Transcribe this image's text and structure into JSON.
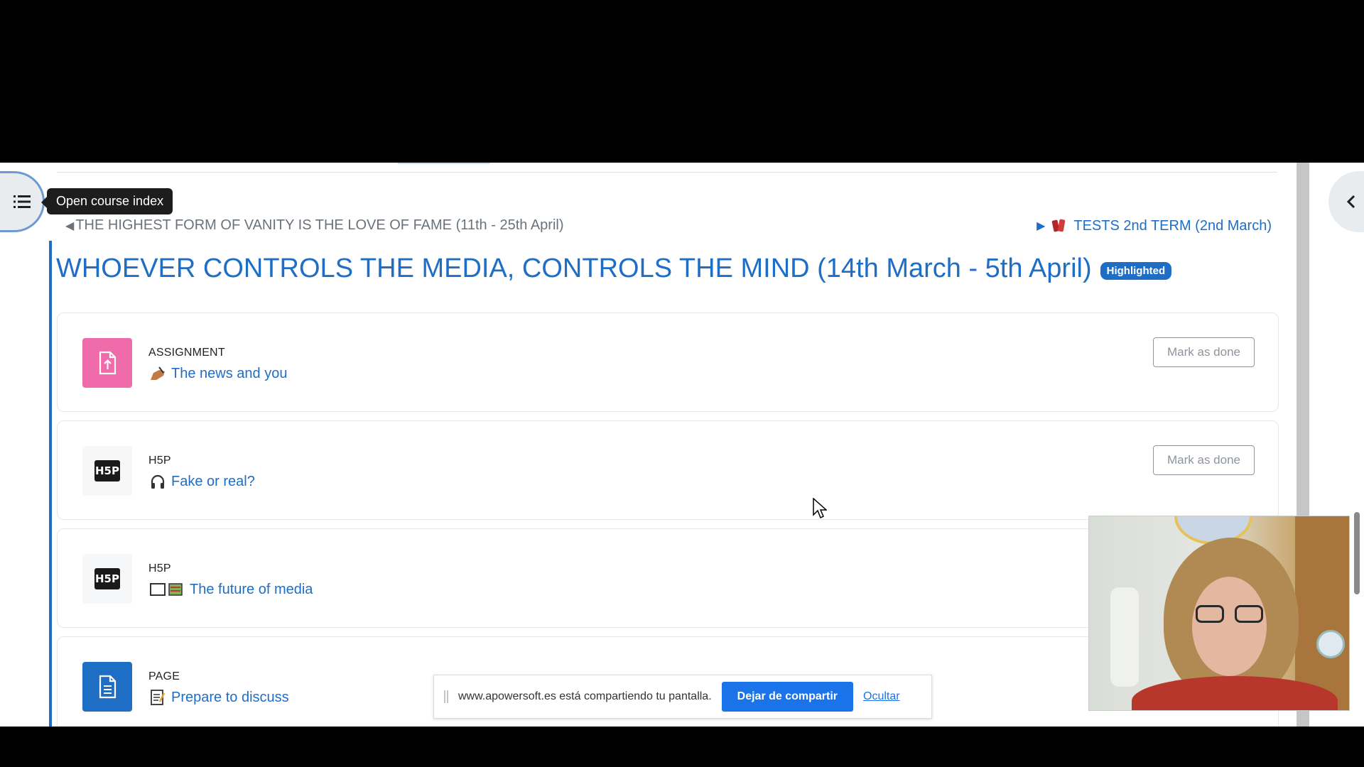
{
  "course_index": {
    "tooltip": "Open course index"
  },
  "nav": {
    "prev_arrow": "◀",
    "prev_label": "THE HIGHEST FORM OF VANITY IS THE LOVE OF FAME (11th - 25th April)",
    "next_arrow": "▶",
    "next_label": "TESTS 2nd TERM (2nd March)"
  },
  "section": {
    "title": "WHOEVER CONTROLS THE MEDIA, CONTROLS THE MIND (14th March - 5th April)",
    "badge": "Highlighted"
  },
  "activities": [
    {
      "type": "ASSIGNMENT",
      "title": "The news and you",
      "icon": "assignment-icon",
      "emoji": "writing-hand-icon",
      "mark_label": "Mark as done"
    },
    {
      "type": "H5P",
      "title": "Fake or real?",
      "icon": "h5p-icon",
      "emoji": "headphones-icon",
      "mark_label": "Mark as done"
    },
    {
      "type": "H5P",
      "title": "The future of media",
      "icon": "h5p-icon",
      "emoji": "book-icon"
    },
    {
      "type": "PAGE",
      "title": "Prepare to discuss",
      "icon": "page-icon",
      "emoji": "memo-icon"
    }
  ],
  "h5p_logo_text": "H5P",
  "share_banner": {
    "message": "www.apowersoft.es está compartiendo tu pantalla.",
    "stop_label": "Dejar de compartir",
    "hide_label": "Ocultar"
  },
  "colors": {
    "link_blue": "#1f6ec6",
    "assignment_pink": "#f06ba9",
    "page_blue": "#1f6ec6",
    "share_blue": "#1a73e8"
  }
}
